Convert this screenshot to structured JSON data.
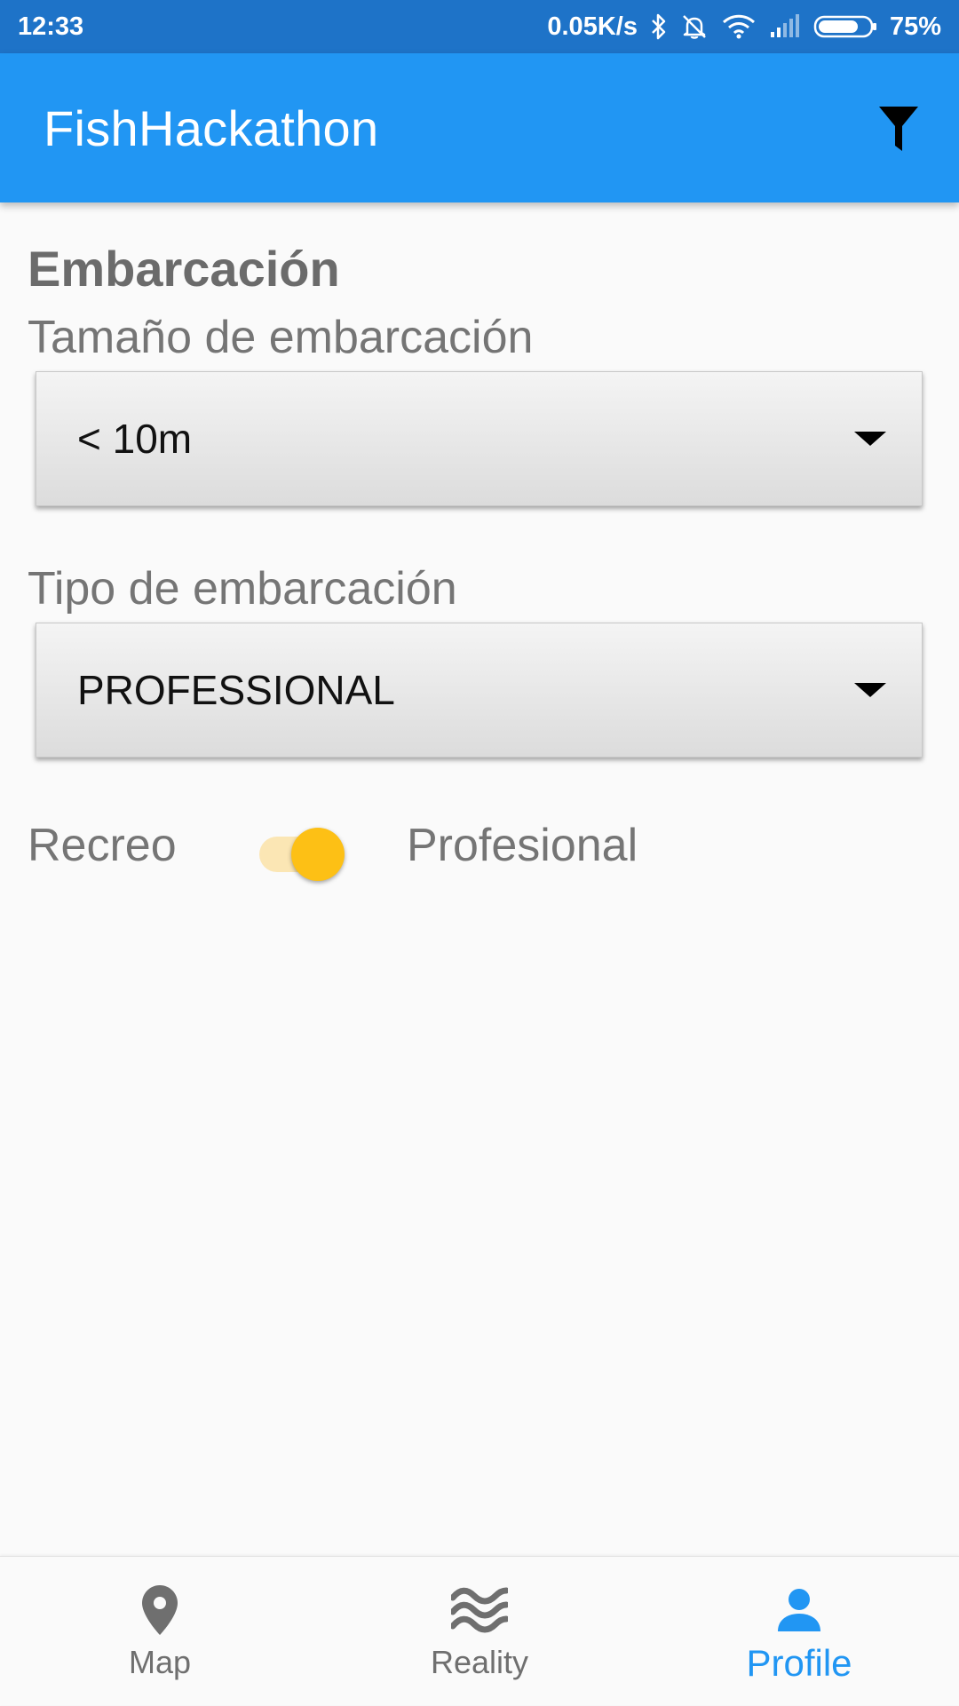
{
  "status_bar": {
    "time": "12:33",
    "speed": "0.05K/s",
    "battery": "75%",
    "icons": [
      "bluetooth-icon",
      "bell-off-icon",
      "wifi-icon",
      "signal-icon",
      "battery-icon"
    ]
  },
  "app_bar": {
    "title": "FishHackathon",
    "action_icon": "filter-icon"
  },
  "form": {
    "section_title": "Embarcación",
    "size_label": "Tamaño de embarcación",
    "size_value": "< 10m",
    "type_label": "Tipo de embarcación",
    "type_value": "PROFESSIONAL",
    "toggle_left_label": "Recreo",
    "toggle_right_label": "Profesional",
    "toggle_on": true
  },
  "bottom_nav": {
    "items": [
      {
        "label": "Map",
        "icon": "map-pin-icon",
        "active": false
      },
      {
        "label": "Reality",
        "icon": "waves-icon",
        "active": false
      },
      {
        "label": "Profile",
        "icon": "person-icon",
        "active": true
      }
    ]
  },
  "colors": {
    "status_bar": "#1e73c8",
    "app_bar": "#2196f3",
    "accent": "#fdc015",
    "active_nav": "#2196f3"
  }
}
